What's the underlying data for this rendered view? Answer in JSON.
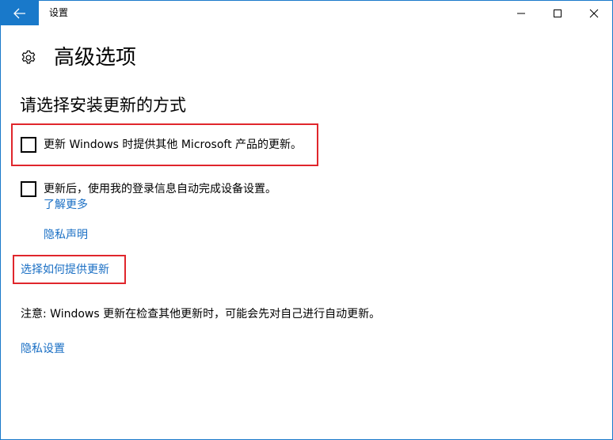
{
  "window": {
    "title": "设置",
    "accent_color": "#1979ca"
  },
  "titlebar": {
    "back_icon": "arrow-left-icon",
    "minimize_icon": "minimize-icon",
    "maximize_icon": "maximize-icon",
    "close_icon": "close-icon"
  },
  "header": {
    "icon": "gear-icon",
    "title": "高级选项"
  },
  "section": {
    "title": "请选择安装更新的方式"
  },
  "options": [
    {
      "label": "更新 Windows 时提供其他 Microsoft 产品的更新。",
      "checked": false,
      "highlighted": true
    },
    {
      "label": "更新后，使用我的登录信息自动完成设备设置。",
      "checked": false,
      "highlighted": false
    }
  ],
  "links": {
    "learn_more": "了解更多",
    "privacy_statement": "隐私声明",
    "choose_delivery": "选择如何提供更新",
    "privacy_settings": "隐私设置"
  },
  "note": "注意: Windows 更新在检查其他更新时，可能会先对自己进行自动更新。",
  "colors": {
    "link": "#1a6fc4",
    "highlight_border": "#e0262c"
  }
}
